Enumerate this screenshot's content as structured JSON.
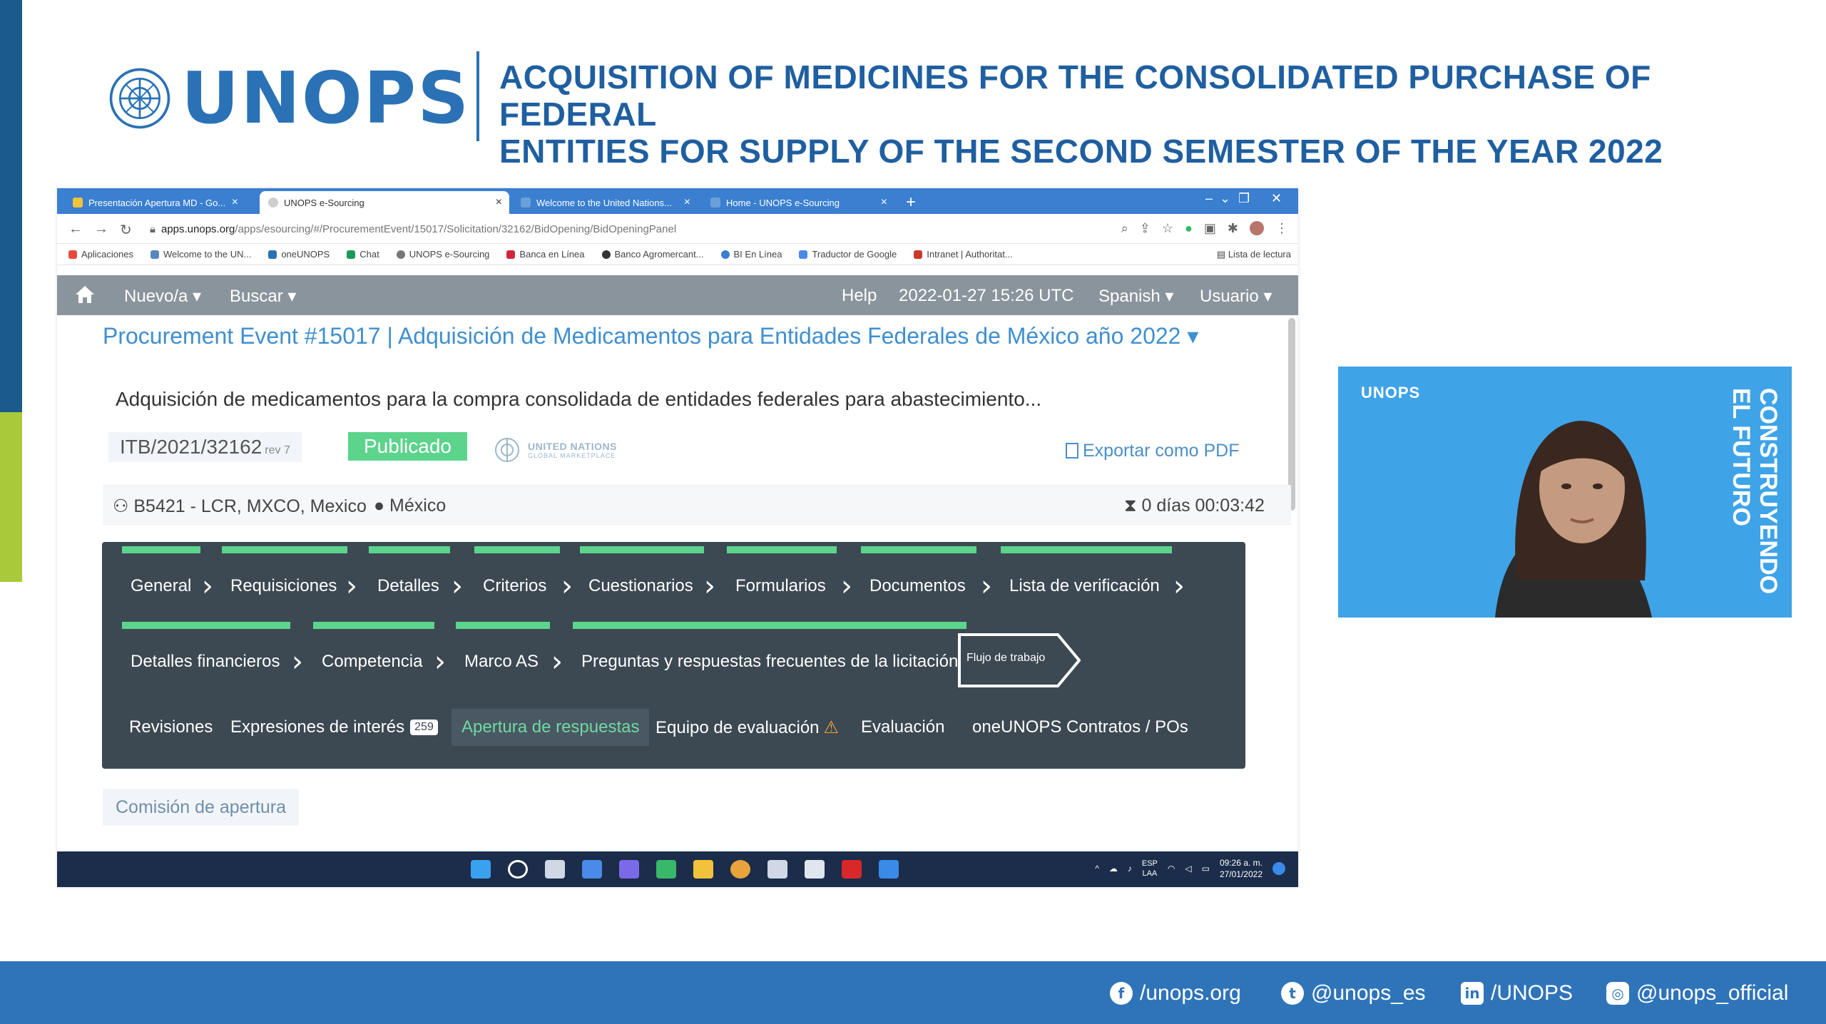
{
  "slide": {
    "logo_text": "UNOPS",
    "title_line1": "ACQUISITION OF MEDICINES FOR THE CONSOLIDATED PURCHASE OF FEDERAL",
    "title_line2": "ENTITIES FOR SUPPLY OF THE SECOND SEMESTER OF THE YEAR 2022",
    "colors": {
      "brand_blue": "#2a72b5",
      "accent_green": "#a8c93a",
      "dark_blue": "#1a5a8c"
    }
  },
  "browser": {
    "tabs": [
      {
        "label": "Presentación Apertura MD - Go...",
        "active": false
      },
      {
        "label": "UNOPS e-Sourcing",
        "active": true
      },
      {
        "label": "Welcome to the United Nations...",
        "active": false
      },
      {
        "label": "Home - UNOPS e-Sourcing",
        "active": false
      }
    ],
    "url_host": "apps.unops.org",
    "url_path": "/apps/esourcing/#/ProcurementEvent/15017/Solicitation/32162/BidOpening/BidOpeningPanel",
    "bookmarks": [
      {
        "label": "Aplicaciones",
        "color": "#e84a3a"
      },
      {
        "label": "Welcome to the UN...",
        "color": "#5a86c0"
      },
      {
        "label": "oneUNOPS",
        "color": "#2a72b5"
      },
      {
        "label": "Chat",
        "color": "#1a9a5a"
      },
      {
        "label": "UNOPS e-Sourcing",
        "color": "#777777"
      },
      {
        "label": "Banca en Línea",
        "color": "#d0283a"
      },
      {
        "label": "Banco Agromercant...",
        "color": "#333333"
      },
      {
        "label": "BI En Línea",
        "color": "#3a7fd0"
      },
      {
        "label": "Traductor de Google",
        "color": "#4a8ae8"
      },
      {
        "label": "Intranet | Authoritat...",
        "color": "#c83a2a"
      }
    ],
    "reading_list": "Lista de lectura"
  },
  "app": {
    "nav": {
      "new_label": "Nuevo/a ▾",
      "search_label": "Buscar ▾",
      "help_label": "Help",
      "datetime": "2022-01-27 15:26 UTC",
      "language": "Spanish ▾",
      "user": "Usuario ▾"
    },
    "event_title": "Procurement Event #15017 | Adquisición de Medicamentos para Entidades Federales de México año 2022 ▾",
    "description": "Adquisición de medicamentos para la compra consolidada de entidades federales para abastecimiento...",
    "itb": "ITB/2021/32162",
    "rev": "rev 7",
    "status": "Publicado",
    "ungm_line1": "UNITED NATIONS",
    "ungm_line2": "GLOBAL MARKETPLACE",
    "export_label": "Exportar como PDF",
    "location": "B5421 - LCR, MXCO, Mexico",
    "country": "México",
    "countdown": "0 días 00:03:42",
    "workflow_row1": [
      "General",
      "Requisiciones",
      "Detalles",
      "Criterios",
      "Cuestionarios",
      "Formularios",
      "Documentos",
      "Lista de verificación"
    ],
    "workflow_row2": [
      "Detalles financieros",
      "Competencia",
      "Marco AS",
      "Preguntas y respuestas frecuentes de la licitación"
    ],
    "workflow_flow": "Flujo de trabajo",
    "subtabs": {
      "revisiones": "Revisiones",
      "expresiones": "Expresiones de interés",
      "expresiones_count": "259",
      "apertura": "Apertura de respuestas",
      "equipo": "Equipo de evaluación",
      "evaluacion": "Evaluación",
      "contratos": "oneUNOPS Contratos / POs"
    },
    "commission": "Comisión de apertura"
  },
  "taskbar": {
    "lang1": "ESP",
    "lang2": "LAA",
    "time": "09:26 a. m.",
    "date": "27/01/2022"
  },
  "video": {
    "logo": "UNOPS",
    "side_text1": "CONSTRUYENDO",
    "side_text2": "EL FUTURO"
  },
  "footer": {
    "facebook": "/unops.org",
    "twitter": "@unops_es",
    "linkedin": "/UNOPS",
    "instagram": "@unops_official"
  }
}
